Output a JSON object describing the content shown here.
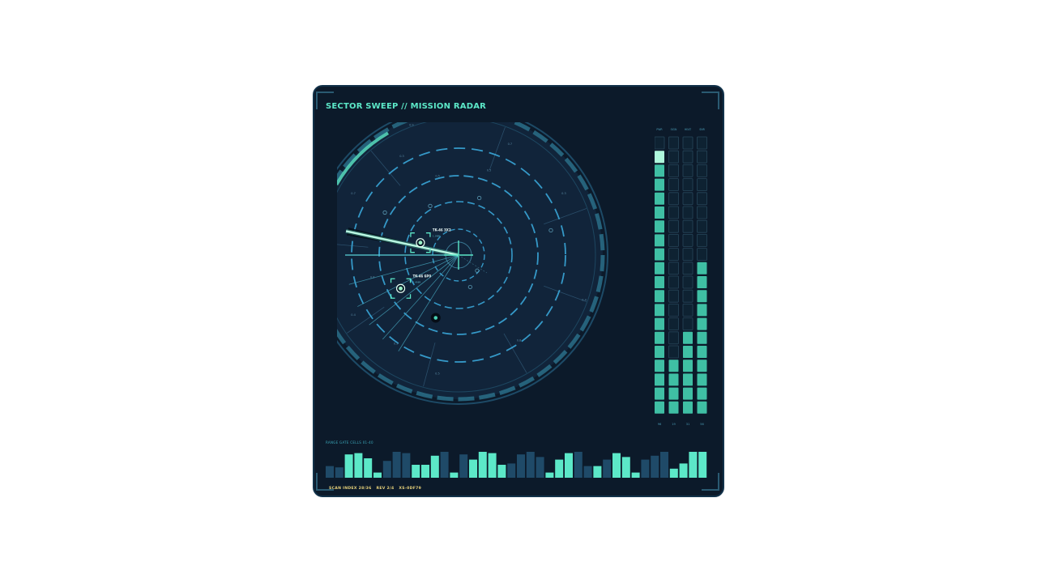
{
  "title": "SECTOR SWEEP // MISSION RADAR",
  "colors": {
    "panel_bg": "#0c1a2a",
    "radar_bg": "#11243a",
    "accent": "#5ce8c8",
    "ring_dash": "#3aa6d8",
    "meter_fill": "#3fbfa4",
    "meter_empty": "#0e2232",
    "strip_dark": "#1f4a68",
    "footer_text": "#e8d27a"
  },
  "radar": {
    "sweep_bearing_deg": 283,
    "targets": [
      {
        "id": "TK-46 3X2",
        "sub": "1.9NM",
        "bearing_deg": 288,
        "range_frac": 0.33,
        "locked": true
      },
      {
        "id": "TK-46 6P0",
        "sub": "2.4NM",
        "bearing_deg": 240,
        "range_frac": 0.55,
        "locked": true
      },
      {
        "id": "",
        "sub": "",
        "bearing_deg": 200,
        "range_frac": 0.55,
        "locked": false
      }
    ],
    "sector_labels": [
      "0.7",
      "0.3",
      "0.5",
      "0.5",
      "0.3",
      "0.4",
      "0.8",
      "0.5",
      "0.3",
      "0.4",
      "0.8",
      "0.4",
      "0.7",
      "0.9"
    ]
  },
  "meters": {
    "labels": [
      "PWR",
      "SIGN",
      "HEAT",
      "SNR"
    ],
    "values": [
      "96",
      "19",
      "31",
      "56"
    ],
    "fractions": [
      0.96,
      0.19,
      0.31,
      0.56
    ]
  },
  "strip": {
    "label": "RANGE GATE CELLS 01-40",
    "values": [
      0.45,
      0.4,
      0.9,
      0.95,
      0.75,
      0.2,
      0.65,
      1.0,
      0.95,
      0.5,
      0.5,
      0.85,
      1.0,
      0.2,
      0.9,
      0.7,
      1.0,
      0.95,
      0.5,
      0.55,
      0.9,
      1.0,
      0.8,
      0.2,
      0.7,
      0.95,
      1.0,
      0.45,
      0.45,
      0.7,
      0.95,
      0.8,
      0.2,
      0.7,
      0.85,
      1.0,
      0.35,
      0.55,
      1.0,
      1.0
    ],
    "bright": [
      0,
      0,
      1,
      1,
      1,
      1,
      0,
      0,
      0,
      1,
      1,
      1,
      0,
      1,
      0,
      1,
      1,
      1,
      1,
      0,
      0,
      0,
      0,
      1,
      1,
      1,
      0,
      0,
      1,
      0,
      1,
      1,
      1,
      0,
      0,
      0,
      1,
      1,
      1,
      1
    ]
  },
  "footer": {
    "scan": "SCAN INDEX 28/36",
    "rev": "REV 2/4",
    "id": "XS-0DF79"
  }
}
